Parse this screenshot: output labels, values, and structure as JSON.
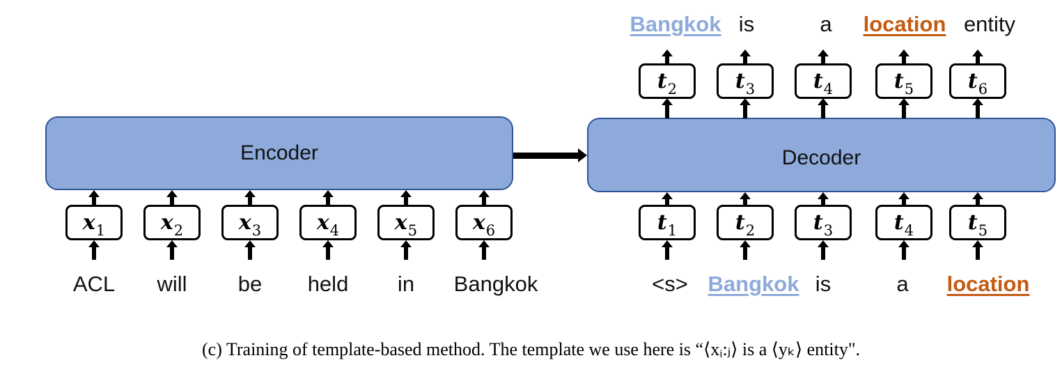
{
  "encoder": {
    "label": "Encoder",
    "tokens": [
      {
        "symbol": "x",
        "sub": "1",
        "word": "ACL"
      },
      {
        "symbol": "x",
        "sub": "2",
        "word": "will"
      },
      {
        "symbol": "x",
        "sub": "3",
        "word": "be"
      },
      {
        "symbol": "x",
        "sub": "4",
        "word": "held"
      },
      {
        "symbol": "x",
        "sub": "5",
        "word": "in"
      },
      {
        "symbol": "x",
        "sub": "6",
        "word": "Bangkok"
      }
    ]
  },
  "decoder": {
    "label": "Decoder",
    "inputs": [
      {
        "symbol": "t",
        "sub": "1",
        "word": "<s>",
        "style": "plain"
      },
      {
        "symbol": "t",
        "sub": "2",
        "word": "Bangkok",
        "style": "entity"
      },
      {
        "symbol": "t",
        "sub": "3",
        "word": "is",
        "style": "plain"
      },
      {
        "symbol": "t",
        "sub": "4",
        "word": "a",
        "style": "plain"
      },
      {
        "symbol": "t",
        "sub": "5",
        "word": "location",
        "style": "type"
      }
    ],
    "outputs": [
      {
        "symbol": "t",
        "sub": "2",
        "word": "Bangkok",
        "style": "entity"
      },
      {
        "symbol": "t",
        "sub": "3",
        "word": "is",
        "style": "plain"
      },
      {
        "symbol": "t",
        "sub": "4",
        "word": "a",
        "style": "plain"
      },
      {
        "symbol": "t",
        "sub": "5",
        "word": "location",
        "style": "type"
      },
      {
        "symbol": "t",
        "sub": "6",
        "word": "entity",
        "style": "plain"
      }
    ]
  },
  "colors": {
    "block_fill": "#8eaadb",
    "block_border": "#2f5597",
    "entity": "#8eaadb",
    "entity_type": "#c55a11"
  },
  "caption": "(c) Training of template-based method. The template we use here is “⟨xᵢ:ⱼ⟩ is a ⟨yₖ⟩ entity\"."
}
